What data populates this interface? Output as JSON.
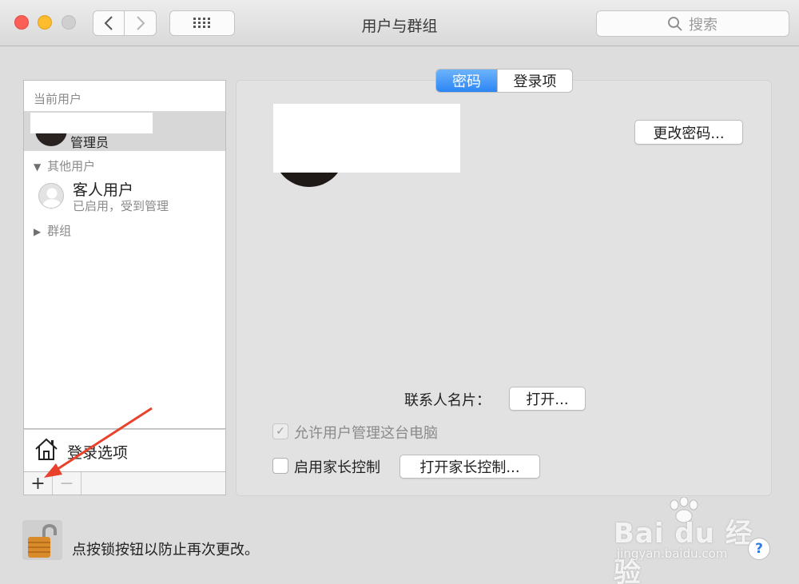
{
  "window": {
    "title": "用户与群组",
    "search_placeholder": "搜索"
  },
  "sidebar": {
    "current_users_header": "当前用户",
    "current_user_role": "管理员",
    "other_users_header": "其他用户",
    "guest_name": "客人用户",
    "guest_status": "已启用，受到管理",
    "groups_header": "群组",
    "login_options": "登录选项",
    "add_symbol": "+",
    "remove_symbol": "−"
  },
  "tabs": {
    "password": "密码",
    "login_items": "登录项"
  },
  "main": {
    "change_password_button": "更改密码...",
    "contact_card_label": "联系人名片：",
    "open_button": "打开...",
    "allow_admin_label": "允许用户管理这台电脑",
    "allow_admin_checked": true,
    "parental_controls_label": "启用家长控制",
    "parental_controls_checked": false,
    "open_parental_controls_button": "打开家长控制..."
  },
  "footer": {
    "lock_text": "点按锁按钮以防止再次更改。",
    "help_symbol": "?"
  },
  "watermark": {
    "logo": "Bai du 经验",
    "url": "jingyan.baidu.com"
  },
  "colors": {
    "accent_blue": "#2c86f6",
    "annotation_red": "#e8412c"
  }
}
